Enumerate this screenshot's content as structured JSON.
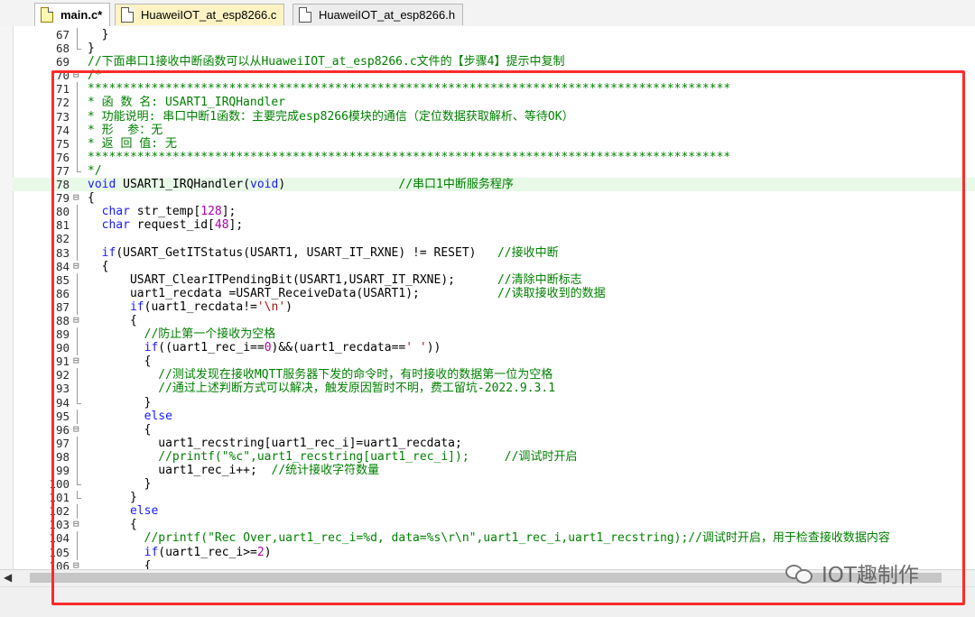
{
  "tabs": [
    {
      "label": "main.c*",
      "active": true
    },
    {
      "label": "HuaweiIOT_at_esp8266.c",
      "active": false
    },
    {
      "label": "HuaweiIOT_at_esp8266.h",
      "active": false
    }
  ],
  "watermark": "IOT趣制作",
  "highlight_color": "#ff2a2a",
  "code_lines": [
    {
      "n": "67",
      "fold": "v",
      "tokens": [
        [
          "",
          "  }"
        ]
      ]
    },
    {
      "n": "68",
      "fold": "end",
      "tokens": [
        [
          "",
          "}"
        ]
      ]
    },
    {
      "n": "69",
      "fold": "",
      "tokens": [
        [
          "cm",
          "//下面串口1接收中断函数可以从HuaweiIOT_at_esp8266.c文件的【步骤4】提示中复制"
        ]
      ]
    },
    {
      "n": "70",
      "fold": "box",
      "tokens": [
        [
          "cm",
          "/*"
        ]
      ]
    },
    {
      "n": "71",
      "fold": "v",
      "tokens": [
        [
          "cm",
          "*******************************************************************************************"
        ]
      ]
    },
    {
      "n": "72",
      "fold": "v",
      "tokens": [
        [
          "cm",
          "* 函 数 名: USART1_IRQHandler"
        ]
      ]
    },
    {
      "n": "73",
      "fold": "v",
      "tokens": [
        [
          "cm",
          "* 功能说明: 串口中断1函数：主要完成esp8266模块的通信（定位数据获取解析、等待OK）"
        ]
      ]
    },
    {
      "n": "74",
      "fold": "v",
      "tokens": [
        [
          "cm",
          "* 形  参：无"
        ]
      ]
    },
    {
      "n": "75",
      "fold": "v",
      "tokens": [
        [
          "cm",
          "* 返 回 值: 无"
        ]
      ]
    },
    {
      "n": "76",
      "fold": "v",
      "tokens": [
        [
          "cm",
          "*******************************************************************************************"
        ]
      ]
    },
    {
      "n": "77",
      "fold": "end",
      "tokens": [
        [
          "cm",
          "*/"
        ]
      ]
    },
    {
      "n": "78",
      "fold": "",
      "cur": true,
      "tokens": [
        [
          "kw",
          "void"
        ],
        [
          "",
          " USART1_IRQHandler("
        ],
        [
          "kw",
          "void"
        ],
        [
          "",
          ")                "
        ],
        [
          "cm",
          "//串口1中断服务程序"
        ]
      ]
    },
    {
      "n": "79",
      "fold": "box",
      "tokens": [
        [
          "",
          "{"
        ]
      ]
    },
    {
      "n": "80",
      "fold": "v",
      "tokens": [
        [
          "",
          "  "
        ],
        [
          "kw",
          "char"
        ],
        [
          "",
          " str_temp["
        ],
        [
          "num",
          "128"
        ],
        [
          "",
          "];"
        ]
      ]
    },
    {
      "n": "81",
      "fold": "v",
      "tokens": [
        [
          "",
          "  "
        ],
        [
          "kw",
          "char"
        ],
        [
          "",
          " request_id["
        ],
        [
          "num",
          "48"
        ],
        [
          "",
          "];"
        ]
      ]
    },
    {
      "n": "82",
      "fold": "v",
      "tokens": [
        [
          "",
          ""
        ]
      ]
    },
    {
      "n": "83",
      "fold": "v",
      "tokens": [
        [
          "",
          "  "
        ],
        [
          "kw",
          "if"
        ],
        [
          "",
          "(USART_GetITStatus(USART1, USART_IT_RXNE) != RESET)   "
        ],
        [
          "cm",
          "//接收中断"
        ]
      ]
    },
    {
      "n": "84",
      "fold": "box",
      "tokens": [
        [
          "",
          "  {"
        ]
      ]
    },
    {
      "n": "85",
      "fold": "v",
      "tokens": [
        [
          "",
          "      USART_ClearITPendingBit(USART1,USART_IT_RXNE);      "
        ],
        [
          "cm",
          "//清除中断标志"
        ]
      ]
    },
    {
      "n": "86",
      "fold": "v",
      "tokens": [
        [
          "",
          "      uart1_recdata =USART_ReceiveData(USART1);           "
        ],
        [
          "cm",
          "//读取接收到的数据"
        ]
      ]
    },
    {
      "n": "87",
      "fold": "v",
      "tokens": [
        [
          "",
          "      "
        ],
        [
          "kw",
          "if"
        ],
        [
          "",
          "(uart1_recdata!="
        ],
        [
          "str",
          "'\\n'"
        ],
        [
          "",
          ")"
        ]
      ]
    },
    {
      "n": "88",
      "fold": "box",
      "tokens": [
        [
          "",
          "      {"
        ]
      ]
    },
    {
      "n": "89",
      "fold": "v",
      "tokens": [
        [
          "",
          "        "
        ],
        [
          "cm",
          "//防止第一个接收为空格"
        ]
      ]
    },
    {
      "n": "90",
      "fold": "v",
      "tokens": [
        [
          "",
          "        "
        ],
        [
          "kw",
          "if"
        ],
        [
          "",
          "((uart1_rec_i=="
        ],
        [
          "num",
          "0"
        ],
        [
          "",
          ")&&(uart1_recdata=="
        ],
        [
          "str",
          "' '"
        ],
        [
          "",
          "))"
        ]
      ]
    },
    {
      "n": "91",
      "fold": "box",
      "tokens": [
        [
          "",
          "        {"
        ]
      ]
    },
    {
      "n": "92",
      "fold": "v",
      "tokens": [
        [
          "",
          "          "
        ],
        [
          "cm",
          "//测试发现在接收MQTT服务器下发的命令时，有时接收的数据第一位为空格"
        ]
      ]
    },
    {
      "n": "93",
      "fold": "v",
      "tokens": [
        [
          "",
          "          "
        ],
        [
          "cm",
          "//通过上述判断方式可以解决，触发原因暂时不明，费工留坑-2022.9.3.1"
        ]
      ]
    },
    {
      "n": "94",
      "fold": "end",
      "tokens": [
        [
          "",
          "        }"
        ]
      ]
    },
    {
      "n": "95",
      "fold": "v",
      "tokens": [
        [
          "",
          "        "
        ],
        [
          "kw",
          "else"
        ]
      ]
    },
    {
      "n": "96",
      "fold": "box",
      "tokens": [
        [
          "",
          "        {"
        ]
      ]
    },
    {
      "n": "97",
      "fold": "v",
      "tokens": [
        [
          "",
          "          uart1_recstring[uart1_rec_i]=uart1_recdata;"
        ]
      ]
    },
    {
      "n": "98",
      "fold": "v",
      "tokens": [
        [
          "",
          "          "
        ],
        [
          "cm",
          "//printf(\"%c\",uart1_recstring[uart1_rec_i]);     //调试时开启"
        ]
      ]
    },
    {
      "n": "99",
      "fold": "v",
      "tokens": [
        [
          "",
          "          uart1_rec_i++;  "
        ],
        [
          "cm",
          "//统计接收字符数量"
        ]
      ]
    },
    {
      "n": "100",
      "fold": "end",
      "tokens": [
        [
          "",
          "        }"
        ]
      ]
    },
    {
      "n": "101",
      "fold": "end",
      "tokens": [
        [
          "",
          "      }"
        ]
      ]
    },
    {
      "n": "102",
      "fold": "v",
      "tokens": [
        [
          "",
          "      "
        ],
        [
          "kw",
          "else"
        ]
      ]
    },
    {
      "n": "103",
      "fold": "box",
      "tokens": [
        [
          "",
          "      {"
        ]
      ]
    },
    {
      "n": "104",
      "fold": "v",
      "tokens": [
        [
          "",
          "        "
        ],
        [
          "cm",
          "//printf(\"Rec Over,uart1_rec_i=%d, data=%s\\r\\n\",uart1_rec_i,uart1_recstring);//调试时开启，用于检查接收数据内容"
        ]
      ]
    },
    {
      "n": "105",
      "fold": "v",
      "tokens": [
        [
          "",
          "        "
        ],
        [
          "kw",
          "if"
        ],
        [
          "",
          "(uart1_rec_i>="
        ],
        [
          "num",
          "2"
        ],
        [
          "",
          ")"
        ]
      ]
    },
    {
      "n": "106",
      "fold": "box",
      "tokens": [
        [
          "",
          "        {"
        ]
      ]
    }
  ]
}
